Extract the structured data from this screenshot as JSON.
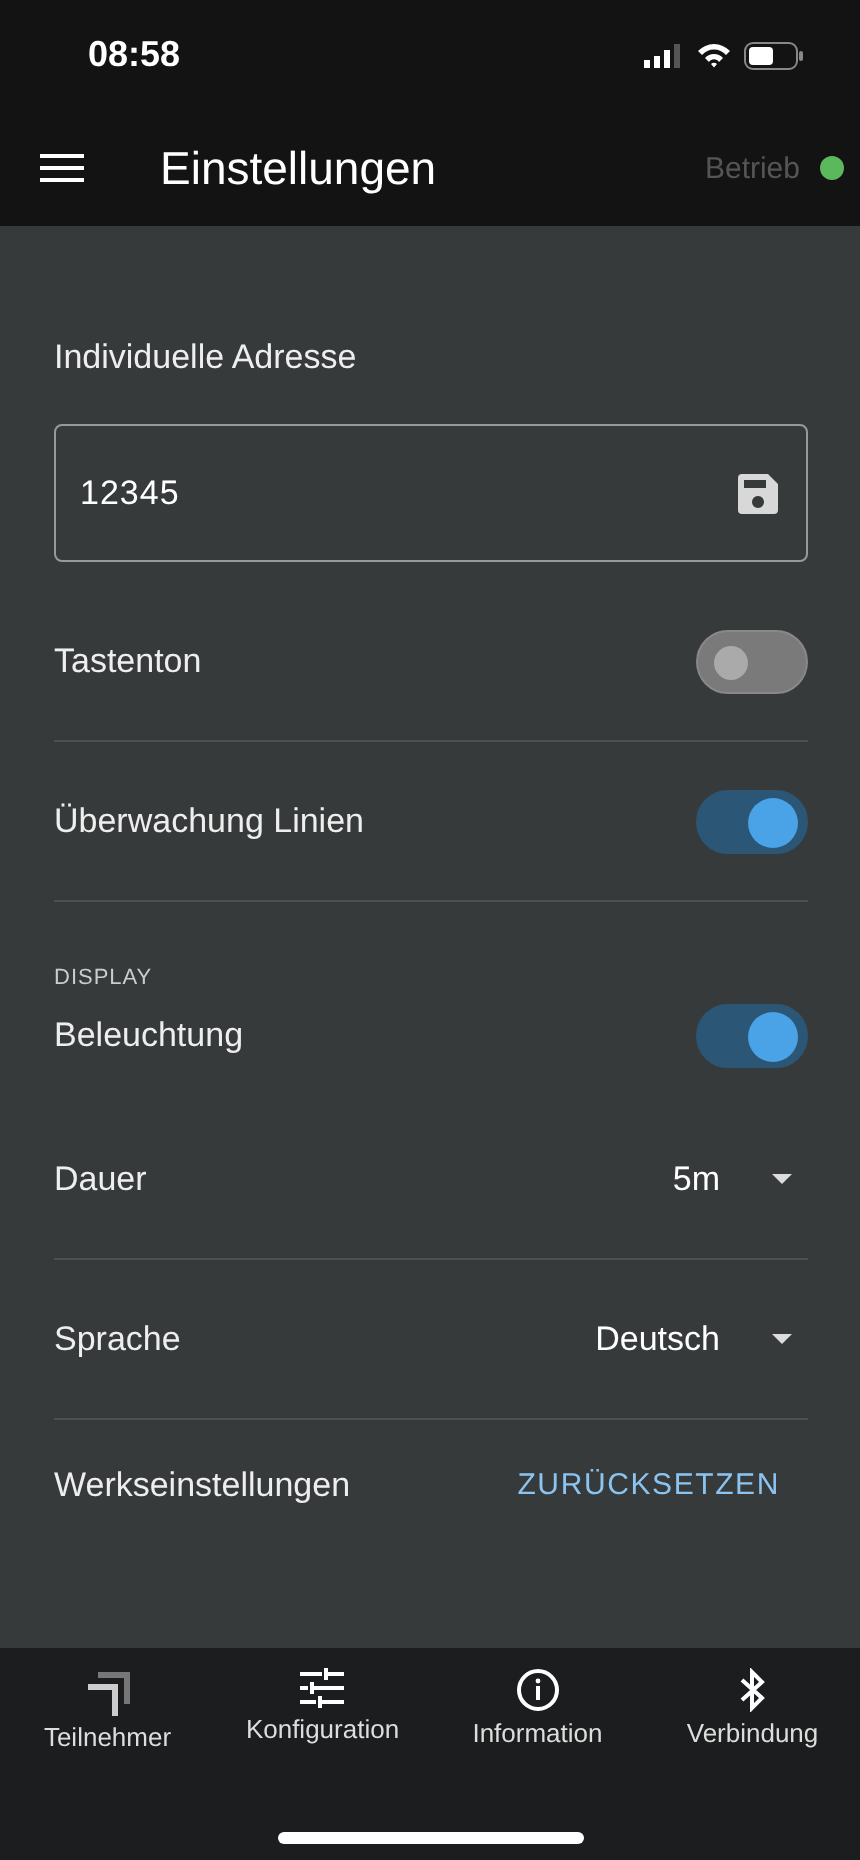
{
  "status_bar": {
    "time": "08:58"
  },
  "header": {
    "title": "Einstellungen",
    "status": {
      "label": "Betrieb",
      "color": "#5cb85c"
    }
  },
  "address": {
    "label": "Individuelle Adresse",
    "value": "12345"
  },
  "items": [
    {
      "kind": "toggle",
      "label": "Tastenton",
      "on": false,
      "divider": true
    },
    {
      "kind": "toggle",
      "label": "Überwachung Linien",
      "on": true,
      "divider": true
    },
    {
      "kind": "section",
      "label": "DISPLAY"
    },
    {
      "kind": "toggle",
      "label": "Beleuchtung",
      "on": true,
      "divider": false
    },
    {
      "kind": "select",
      "label": "Dauer",
      "value": "5m",
      "divider": true
    },
    {
      "kind": "select",
      "label": "Sprache",
      "value": "Deutsch",
      "divider": true
    },
    {
      "kind": "action",
      "label": "Werkseinstellungen",
      "action": "ZURÜCKSETZEN",
      "divider": false
    }
  ],
  "tabs": [
    {
      "label": "Teilnehmer"
    },
    {
      "label": "Konfiguration"
    },
    {
      "label": "Information"
    },
    {
      "label": "Verbindung"
    }
  ]
}
